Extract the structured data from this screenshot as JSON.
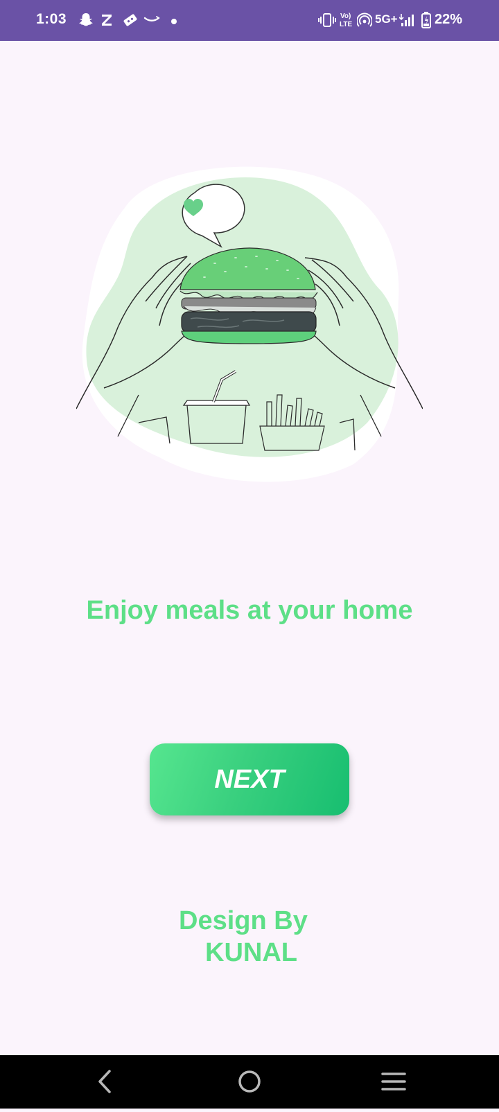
{
  "status_bar": {
    "time": "1:03",
    "left_icons": [
      "snapchat-icon",
      "zomato-z-icon",
      "ticket-icon",
      "amazon-smile-icon",
      "dot-icon"
    ],
    "network": "5G+",
    "battery_percent": "22%"
  },
  "onboarding": {
    "illustration": "burger-with-hands-illustration",
    "tagline": "Enjoy meals at your home",
    "next_label": "NEXT",
    "credit_line1": "Design By",
    "credit_line2": "KUNAL"
  },
  "colors": {
    "status_bar_bg": "#6a52a6",
    "page_bg": "#fbf4fc",
    "accent_green": "#5ddf87",
    "button_gradient_start": "#56e68f",
    "button_gradient_end": "#17be70"
  },
  "nav_bar": {
    "buttons": [
      "back-icon",
      "home-icon",
      "recents-icon"
    ]
  }
}
